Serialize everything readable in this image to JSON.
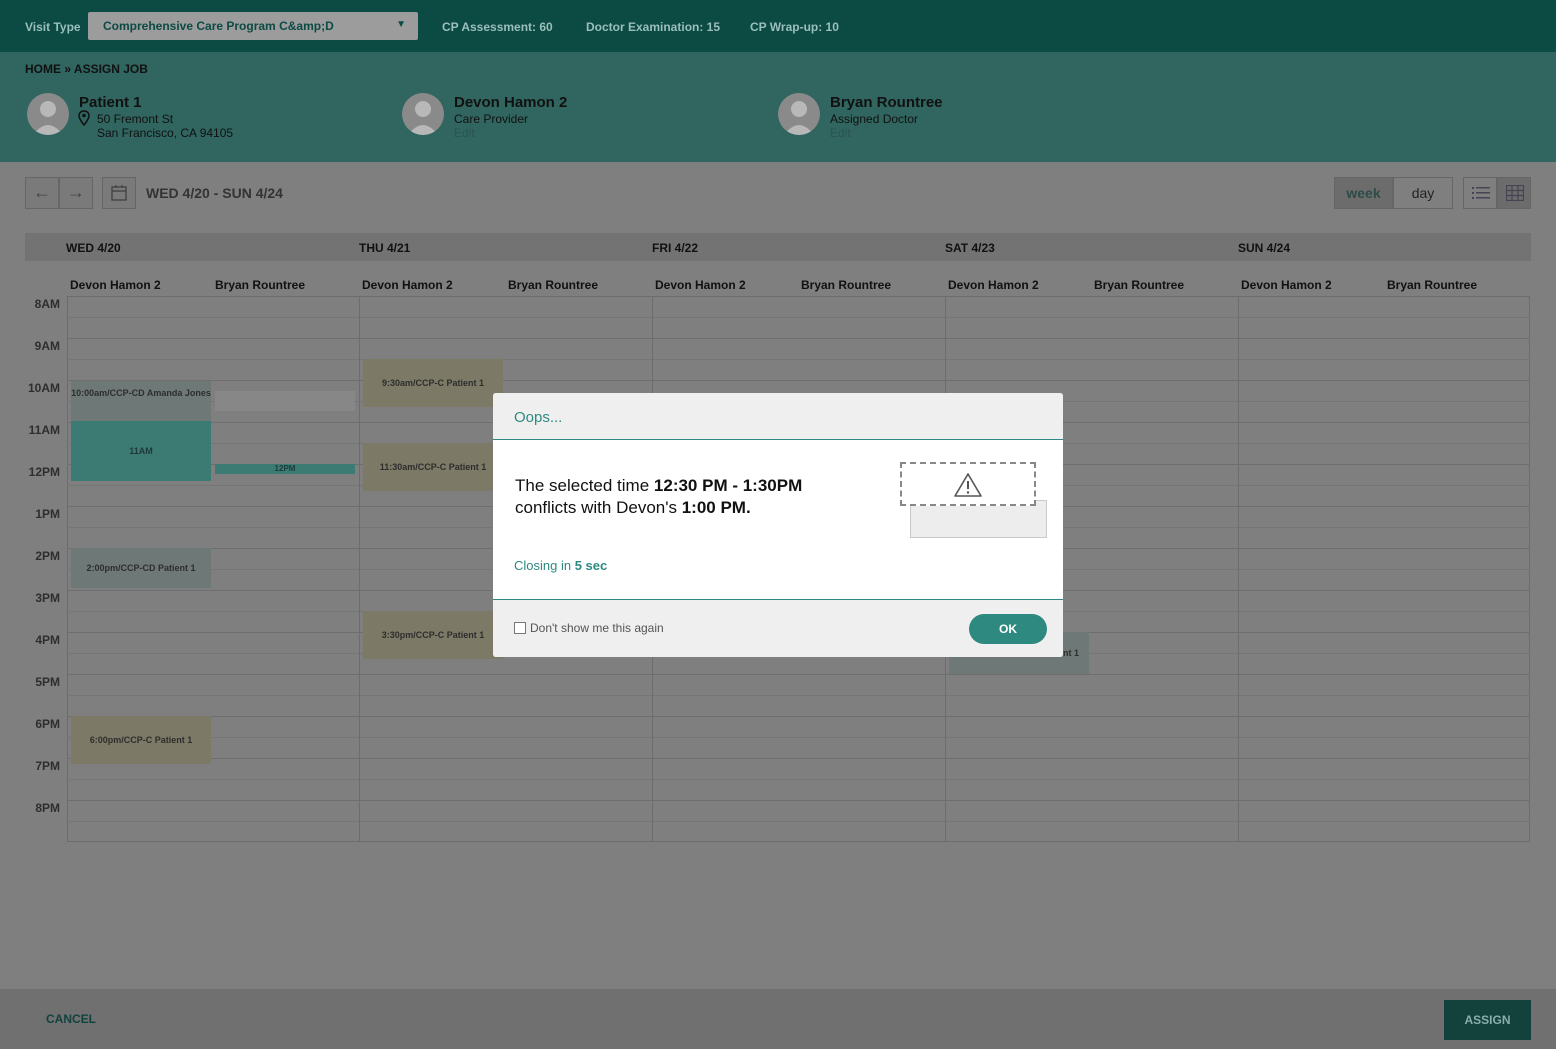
{
  "topbar": {
    "visit_type_label": "Visit Type",
    "visit_type_value": "Comprehensive Care Program C&amp;D",
    "stats": [
      "CP Assessment: 60",
      "Doctor Examination: 15",
      "CP Wrap-up: 10"
    ]
  },
  "header": {
    "breadcrumb": "HOME » ASSIGN JOB",
    "patient": {
      "name": "Patient 1",
      "address1": "50 Fremont St",
      "address2": "San Francisco, CA 94105"
    },
    "provider": {
      "name": "Devon Hamon 2",
      "role": "Care Provider",
      "edit": "Edit"
    },
    "doctor": {
      "name": "Bryan Rountree",
      "role": "Assigned Doctor",
      "edit": "Edit"
    }
  },
  "toolbar": {
    "date_range": "WED 4/20 - SUN 4/24",
    "week_label": "week",
    "day_label": "day",
    "active_view": "week"
  },
  "calendar": {
    "days": [
      "WED 4/20",
      "THU 4/21",
      "FRI 4/22",
      "SAT 4/23",
      "SUN 4/24"
    ],
    "staff": [
      "Devon Hamon 2",
      "Bryan Rountree"
    ],
    "hours": [
      "8AM",
      "9AM",
      "10AM",
      "11AM",
      "12PM",
      "1PM",
      "2PM",
      "3PM",
      "4PM",
      "5PM",
      "6PM",
      "7PM",
      "8PM"
    ],
    "events": {
      "wed_1000": "10:00am/CCP-CD Amanda Jones",
      "wed_11am": "11AM",
      "wed_12pm": "12PM",
      "wed_200": "2:00pm/CCP-CD Patient 1",
      "wed_600": "6:00pm/CCP-C Patient 1",
      "thu_930": "9:30am/CCP-C Patient 1",
      "thu_1130": "11:30am/CCP-C Patient 1",
      "thu_330": "3:30pm/CCP-C Patient 1",
      "sat_partial": "nt 1"
    }
  },
  "modal": {
    "title": "Oops...",
    "msg_prefix": "The selected time ",
    "msg_time": "12:30 PM - 1:30PM",
    "msg_mid": "conflicts with Devon's ",
    "msg_conflict": "1:00 PM.",
    "closing_prefix": "Closing in ",
    "closing_value": "5 sec",
    "checkbox_label": "Don't show me this again",
    "ok_label": "OK"
  },
  "footer": {
    "cancel_label": "CANCEL",
    "assign_label": "ASSIGN"
  },
  "colors": {
    "teal": "#2e8a80",
    "dark_teal": "#0c4a44"
  }
}
